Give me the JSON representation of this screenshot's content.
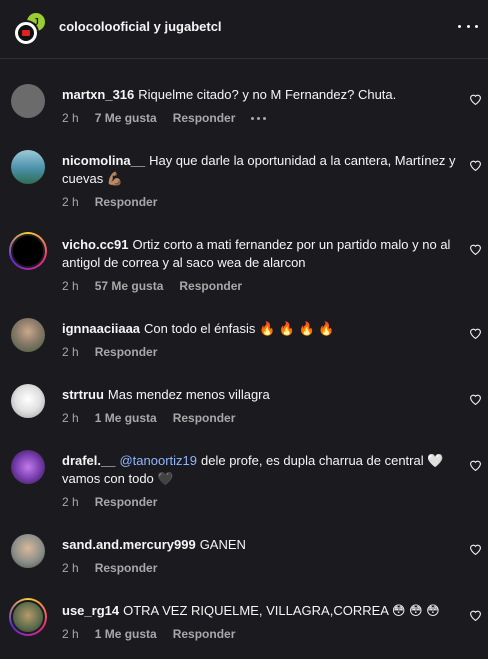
{
  "header": {
    "title": "colocolooficial y jugabetcl",
    "club_logo_icon": "colo-colo-crest-icon",
    "brand_logo_icon": "jugabet-logo-icon"
  },
  "comments": [
    {
      "user": "martxn_316",
      "mention": "",
      "text": "Riquelme citado? y no M Fernandez? Chuta.",
      "time": "2 h",
      "likes": "7 Me gusta",
      "reply": "Responder",
      "avatar_color": "#6b6b6b"
    },
    {
      "user": "nicomolina__",
      "mention": "",
      "text": "Hay que darle la oportunidad a la cantera, Martínez y cuevas 💪🏽",
      "time": "2 h",
      "likes": "",
      "reply": "Responder",
      "avatar_color": "#4a90a8"
    },
    {
      "user": "vicho.cc91",
      "mention": "",
      "text": "Ortiz corto a mati fernandez por un partido malo y no al antigol de correa y al saco wea de alarcon",
      "time": "2 h",
      "likes": "57 Me gusta",
      "reply": "Responder",
      "avatar_color": "#000000"
    },
    {
      "user": "ignnaaciiaaa",
      "mention": "",
      "text": "Con todo el énfasis 🔥 🔥 🔥 🔥",
      "time": "2 h",
      "likes": "",
      "reply": "Responder",
      "avatar_color": "#8a7a6a"
    },
    {
      "user": "strtruu",
      "mention": "",
      "text": "Mas mendez menos villagra",
      "time": "2 h",
      "likes": "1 Me gusta",
      "reply": "Responder",
      "avatar_color": "#e8e8e8"
    },
    {
      "user": "drafel.__",
      "mention": "@tanoortiz19",
      "text": "dele profe, es dupla charrua de central 🤍 vamos con todo 🖤",
      "time": "2 h",
      "likes": "",
      "reply": "Responder",
      "avatar_color": "#7a3fb0"
    },
    {
      "user": "sand.and.mercury999",
      "mention": "",
      "text": "GANEN",
      "time": "2 h",
      "likes": "",
      "reply": "Responder",
      "avatar_color": "#8a8f88"
    },
    {
      "user": "use_rg14",
      "mention": "",
      "text": "OTRA VEZ RIQUELME, VILLAGRA,CORREA 😳 😳 😳",
      "time": "2 h",
      "likes": "1 Me gusta",
      "reply": "Responder",
      "avatar_color": "#5a6a4a"
    }
  ]
}
